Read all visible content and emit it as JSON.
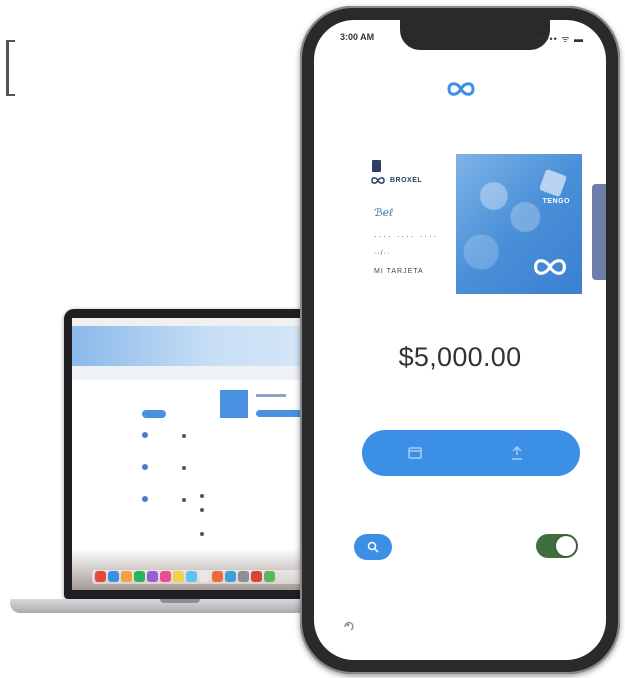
{
  "phone": {
    "status_time": "3:00 AM",
    "status_right": "••••• ᯤ ▬",
    "card": {
      "brand": "BROXEL",
      "signature": "ℬℯℓ",
      "masked_number": "···· ···· ····",
      "expiry": "··/··",
      "label": "MI TARJETA",
      "issuer": "TENGO"
    },
    "balance": "$5,000.00",
    "toggle_on": true
  },
  "colors": {
    "accent": "#3b8fe5",
    "toggle": "#3f6f3f",
    "card": "#4a90d8"
  },
  "icons": {
    "logo": "infinity-icon",
    "search": "search-icon",
    "left_action": "card-icon",
    "right_action": "transfer-icon",
    "corner": "settings-icon"
  }
}
